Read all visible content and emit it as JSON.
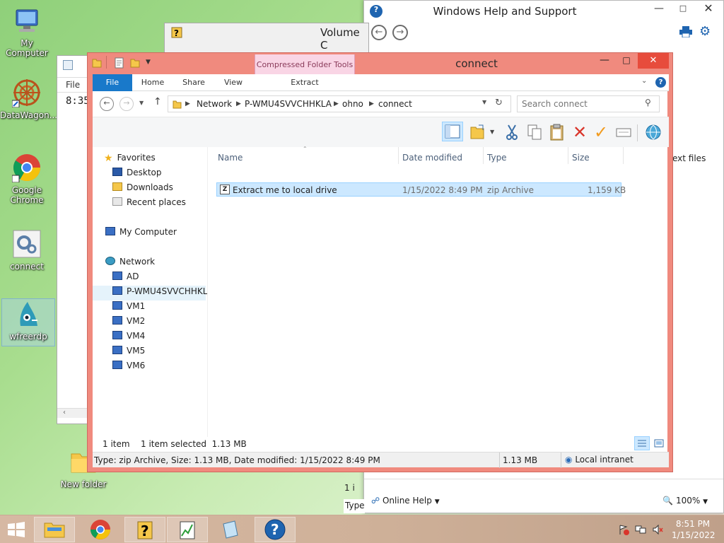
{
  "desktop": {
    "icons": [
      {
        "label": "My Computer"
      },
      {
        "label": "DataWagon..."
      },
      {
        "label": "Google Chrome"
      },
      {
        "label": "connect"
      },
      {
        "label": "wfreerdp"
      },
      {
        "label": "New folder"
      }
    ]
  },
  "help_window": {
    "title": "Windows Help and Support",
    "partial_text": "ext files",
    "online_help": "Online Help",
    "zoom": "100%",
    "status_partial": "Type",
    "item_partial": "1 i"
  },
  "volume_window": {
    "title_partial": "Volume C"
  },
  "notepad": {
    "menu_file": "File",
    "text": "8:35"
  },
  "explorer": {
    "title": "connect",
    "contextual_tab_group": "Compressed Folder Tools",
    "ribbon_tabs": {
      "file": "File",
      "home": "Home",
      "share": "Share",
      "view": "View",
      "extract": "Extract"
    },
    "breadcrumb": [
      "Network",
      "P-WMU4SVVCHHKLA",
      "ohno",
      "connect"
    ],
    "search_placeholder": "Search connect",
    "nav": {
      "favorites": "Favorites",
      "desktop": "Desktop",
      "downloads": "Downloads",
      "recent": "Recent places",
      "my_computer": "My Computer",
      "network": "Network",
      "hosts": [
        "AD",
        "P-WMU4SVVCHHKL",
        "VM1",
        "VM2",
        "VM4",
        "VM5",
        "VM6"
      ]
    },
    "columns": {
      "name": "Name",
      "date": "Date modified",
      "type": "Type",
      "size": "Size"
    },
    "files": [
      {
        "name": "Extract me to local drive",
        "date": "1/15/2022 8:49 PM",
        "type": "zip Archive",
        "size": "1,159 KB"
      }
    ],
    "status": {
      "count": "1 item",
      "selected": "1 item selected  1.13 MB"
    },
    "details_bar": {
      "info": "Type: zip Archive, Size: 1.13 MB, Date modified: 1/15/2022 8:49 PM",
      "size": "1.13 MB",
      "zone": "Local intranet"
    }
  },
  "taskbar": {
    "time": "8:51 PM",
    "date": "1/15/2022"
  },
  "colors": {
    "explorer_frame": "#f08a7e",
    "ribbon_file": "#1979ca",
    "selection": "#cce8ff",
    "contextual_tab": "#f9d5e5"
  }
}
